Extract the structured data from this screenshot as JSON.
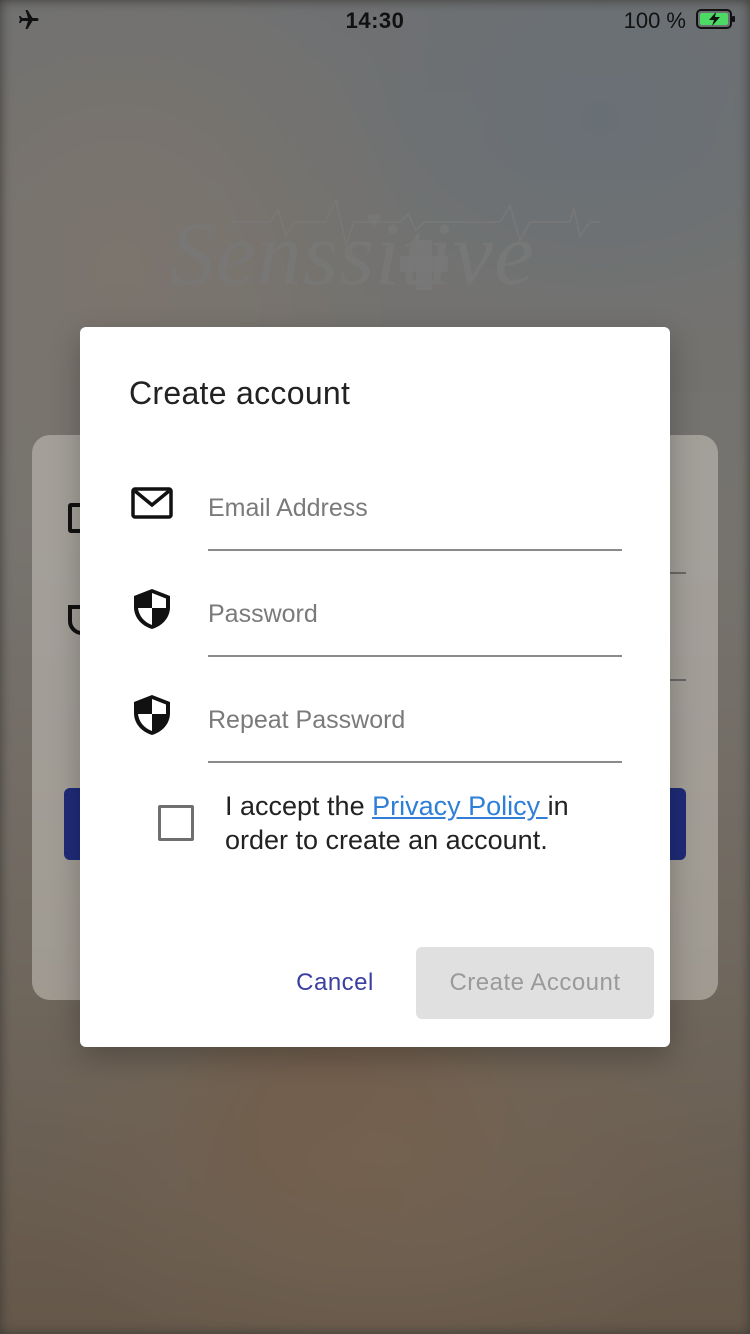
{
  "status_bar": {
    "time": "14:30",
    "battery_percent": "100 %",
    "airplane_mode_icon": "airplane-icon",
    "battery_icon": "battery-charging-icon",
    "battery_color": "#4cd964"
  },
  "logo": {
    "text": "Senssitive"
  },
  "dialog": {
    "title": "Create account",
    "fields": [
      {
        "icon": "envelope-icon",
        "placeholder": "Email Address",
        "value": ""
      },
      {
        "icon": "shield-icon",
        "placeholder": "Password",
        "value": ""
      },
      {
        "icon": "shield-icon",
        "placeholder": "Repeat Password",
        "value": ""
      }
    ],
    "consent": {
      "prefix": "I accept the ",
      "link": "Privacy Policy ",
      "suffix": "in order to create an account.",
      "checked": false
    },
    "actions": {
      "cancel_label": "Cancel",
      "create_label": "Create Account"
    }
  },
  "colors": {
    "link": "#2f7fd8",
    "cancel_text": "#3a3fa0",
    "disabled_button_bg": "#e0e0e0",
    "disabled_button_text": "#9a9a9a"
  }
}
